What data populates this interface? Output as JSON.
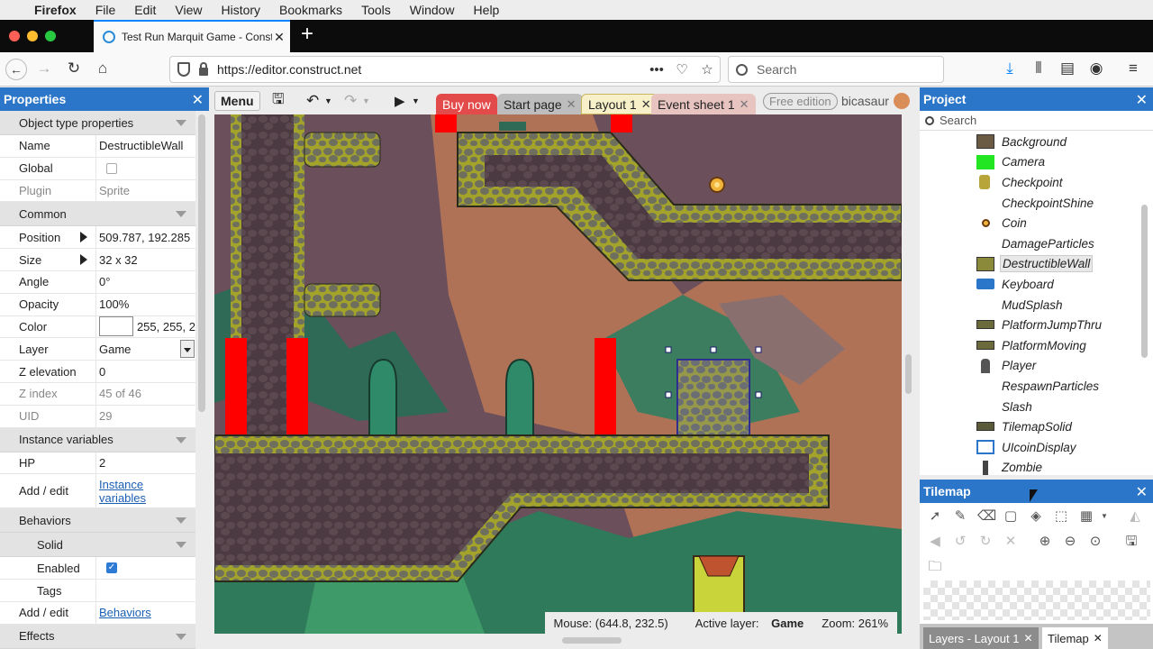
{
  "mac_menu": {
    "app": "Firefox",
    "items": [
      "File",
      "Edit",
      "View",
      "History",
      "Bookmarks",
      "Tools",
      "Window",
      "Help"
    ]
  },
  "browser": {
    "tab_title": "Test Run Marquit Game - Const",
    "url": "https://editor.construct.net",
    "search_placeholder": "Search"
  },
  "properties": {
    "title": "Properties",
    "sections": {
      "object_type": "Object type properties",
      "common": "Common",
      "instance_vars": "Instance variables",
      "behaviors": "Behaviors",
      "effects": "Effects"
    },
    "name": {
      "label": "Name",
      "value": "DestructibleWall"
    },
    "global": {
      "label": "Global"
    },
    "plugin": {
      "label": "Plugin",
      "value": "Sprite"
    },
    "position": {
      "label": "Position",
      "value": "509.787, 192.285"
    },
    "size": {
      "label": "Size",
      "value": "32 x 32"
    },
    "angle": {
      "label": "Angle",
      "value": "0°"
    },
    "opacity": {
      "label": "Opacity",
      "value": "100%"
    },
    "color": {
      "label": "Color",
      "value": "255, 255, 2"
    },
    "layer": {
      "label": "Layer",
      "value": "Game"
    },
    "zelev": {
      "label": "Z elevation",
      "value": "0"
    },
    "zindex": {
      "label": "Z index",
      "value": "45 of 46"
    },
    "uid": {
      "label": "UID",
      "value": "29"
    },
    "hp": {
      "label": "HP",
      "value": "2"
    },
    "addedit_iv": {
      "label": "Add / edit",
      "link1": "Instance",
      "link2": "variables"
    },
    "solid": {
      "label": "Solid"
    },
    "enabled": {
      "label": "Enabled"
    },
    "tags": {
      "label": "Tags"
    },
    "addedit_beh": {
      "label": "Add / edit",
      "link": "Behaviors"
    }
  },
  "editor": {
    "menu": "Menu",
    "tabs": {
      "buy": "Buy now",
      "start": "Start page",
      "layout": "Layout 1",
      "events": "Event sheet 1"
    },
    "free_edition": "Free edition",
    "user": "bicasaur",
    "status": {
      "mouse": "Mouse: (644.8, 232.5)",
      "layer_label": "Active layer:",
      "layer_value": "Game",
      "zoom": "Zoom: 261%"
    }
  },
  "project": {
    "title": "Project",
    "search_placeholder": "Search",
    "items": [
      {
        "name": "Background",
        "icon": "background-thumb-icon"
      },
      {
        "name": "Camera",
        "icon": "green-square-icon"
      },
      {
        "name": "Checkpoint",
        "icon": "checkpoint-icon"
      },
      {
        "name": "CheckpointShine",
        "icon": "none"
      },
      {
        "name": "Coin",
        "icon": "coin-icon"
      },
      {
        "name": "DamageParticles",
        "icon": "none"
      },
      {
        "name": "DestructibleWall",
        "icon": "wall-thumb-icon"
      },
      {
        "name": "Keyboard",
        "icon": "keyboard-icon"
      },
      {
        "name": "MudSplash",
        "icon": "none"
      },
      {
        "name": "PlatformJumpThru",
        "icon": "platform-thumb-icon"
      },
      {
        "name": "PlatformMoving",
        "icon": "platform-thumb-icon"
      },
      {
        "name": "Player",
        "icon": "player-icon"
      },
      {
        "name": "RespawnParticles",
        "icon": "none"
      },
      {
        "name": "Slash",
        "icon": "none"
      },
      {
        "name": "TilemapSolid",
        "icon": "tilemap-thumb-icon"
      },
      {
        "name": "UIcoinDisplay",
        "icon": "text-icon"
      },
      {
        "name": "Zombie",
        "icon": "zombie-icon"
      }
    ]
  },
  "tilemap": {
    "title": "Tilemap",
    "bottom_tabs": {
      "layers": "Layers - Layout 1",
      "tilemap": "Tilemap"
    }
  },
  "colors": {
    "panel_header": "#2b76c8",
    "buy_tab": "#e34a4a",
    "spawn_marker": "#ff0000",
    "platform": "#a8a830",
    "stone": "#6b6a5a"
  }
}
